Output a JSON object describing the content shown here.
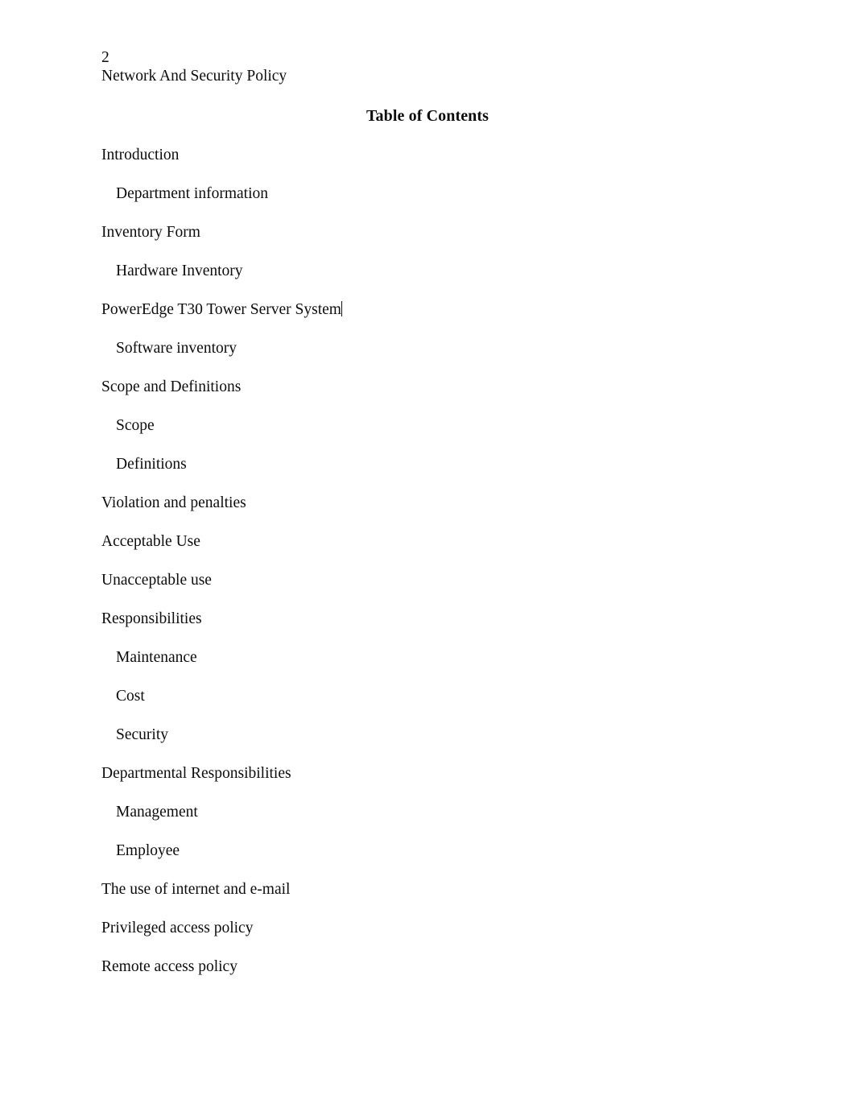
{
  "document": {
    "page_number": "2",
    "running_header": "Network And Security Policy",
    "heading": "Table of Contents"
  },
  "toc": {
    "entries": [
      {
        "label": "Introduction",
        "level": 1,
        "caret": false
      },
      {
        "label": "Department information",
        "level": 2,
        "caret": false
      },
      {
        "label": "Inventory Form",
        "level": 1,
        "caret": false
      },
      {
        "label": "Hardware Inventory",
        "level": 2,
        "caret": false
      },
      {
        "label": "PowerEdge T30 Tower Server System",
        "level": 1,
        "caret": true
      },
      {
        "label": "Software inventory",
        "level": 2,
        "caret": false
      },
      {
        "label": "Scope and Definitions",
        "level": 1,
        "caret": false
      },
      {
        "label": "Scope",
        "level": 2,
        "caret": false
      },
      {
        "label": "Definitions",
        "level": 2,
        "caret": false
      },
      {
        "label": "Violation and penalties",
        "level": 1,
        "caret": false
      },
      {
        "label": "Acceptable Use",
        "level": 1,
        "caret": false
      },
      {
        "label": "Unacceptable use",
        "level": 1,
        "caret": false
      },
      {
        "label": "Responsibilities",
        "level": 1,
        "caret": false
      },
      {
        "label": "Maintenance",
        "level": 2,
        "caret": false
      },
      {
        "label": "Cost",
        "level": 2,
        "caret": false
      },
      {
        "label": "Security",
        "level": 2,
        "caret": false
      },
      {
        "label": "Departmental Responsibilities",
        "level": 1,
        "caret": false
      },
      {
        "label": "Management",
        "level": 2,
        "caret": false
      },
      {
        "label": "Employee",
        "level": 2,
        "caret": false
      },
      {
        "label": "The use of internet and e-mail",
        "level": 1,
        "caret": false
      },
      {
        "label": "Privileged access policy",
        "level": 1,
        "caret": false
      },
      {
        "label": "Remote access policy",
        "level": 1,
        "caret": false
      }
    ]
  },
  "colors": {
    "page_background": "#ffffff",
    "text": "#0d0d0d",
    "caret": "#111111"
  }
}
